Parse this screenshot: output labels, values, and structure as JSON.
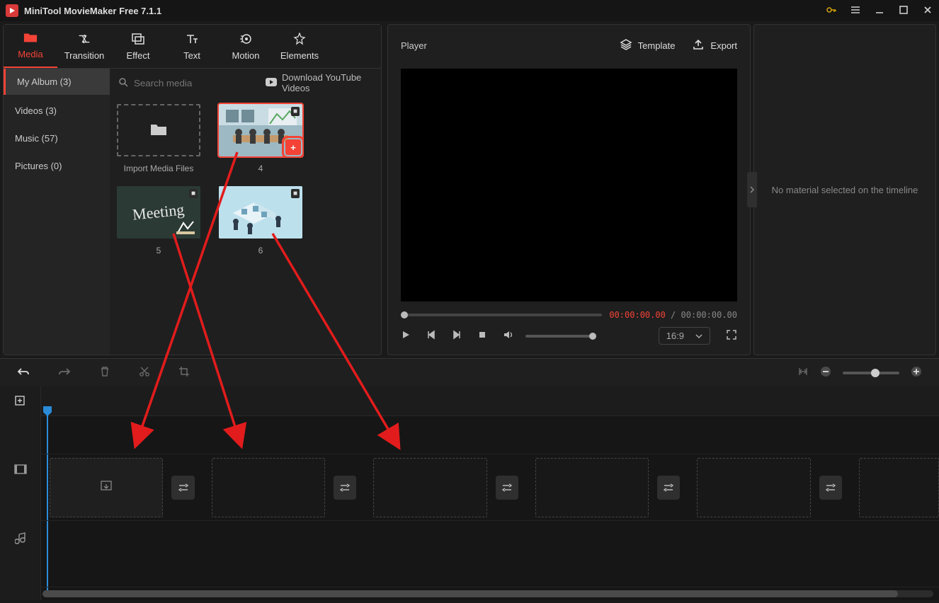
{
  "app": {
    "title": "MiniTool MovieMaker Free 7.1.1"
  },
  "tabs": {
    "media": "Media",
    "transition": "Transition",
    "effect": "Effect",
    "text": "Text",
    "motion": "Motion",
    "elements": "Elements"
  },
  "sidebar": {
    "album": "My Album (3)",
    "videos": "Videos (3)",
    "music": "Music (57)",
    "pictures": "Pictures (0)"
  },
  "search": {
    "placeholder": "Search media"
  },
  "download_yt": "Download YouTube Videos",
  "media_items": {
    "import": "Import Media Files",
    "item4": "4",
    "item5": "5",
    "item6": "6",
    "meeting_word": "Meeting"
  },
  "player": {
    "label": "Player",
    "template": "Template",
    "export": "Export",
    "time_current": "00:00:00.00",
    "time_sep": " / ",
    "time_total": "00:00:00.00",
    "ratio": "16:9"
  },
  "inspector": {
    "empty": "No material selected on the timeline"
  }
}
